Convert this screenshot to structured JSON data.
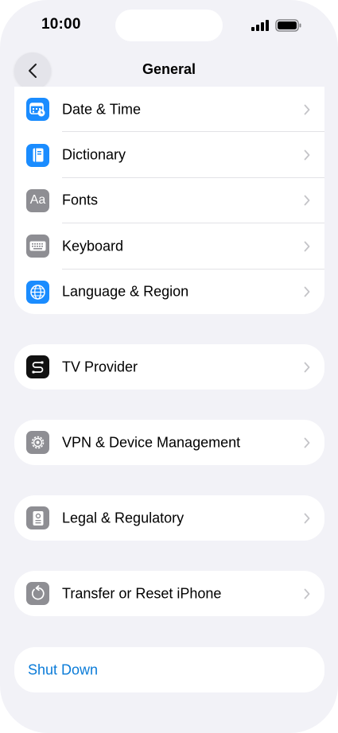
{
  "status_bar": {
    "time": "10:00"
  },
  "nav": {
    "title": "General"
  },
  "groups": {
    "main": [
      {
        "label": "Date & Time",
        "icon": "calendar-clock-icon",
        "color": "#1a8cff"
      },
      {
        "label": "Dictionary",
        "icon": "book-icon",
        "color": "#1a8cff"
      },
      {
        "label": "Fonts",
        "icon": "fonts-icon",
        "icon_text": "Aa",
        "color": "#8e8e93"
      },
      {
        "label": "Keyboard",
        "icon": "keyboard-icon",
        "color": "#8e8e93"
      },
      {
        "label": "Language & Region",
        "icon": "globe-icon",
        "color": "#1a8cff"
      }
    ],
    "tv": {
      "label": "TV Provider",
      "icon": "tv-provider-icon",
      "color": "#111111"
    },
    "vpn": {
      "label": "VPN & Device Management",
      "icon": "gear-icon",
      "color": "#8e8e93"
    },
    "legal": {
      "label": "Legal & Regulatory",
      "icon": "legal-document-icon",
      "color": "#8e8e93"
    },
    "transfer": {
      "label": "Transfer or Reset iPhone",
      "icon": "reset-arrow-icon",
      "color": "#8e8e93"
    },
    "shutdown": {
      "label": "Shut Down",
      "color": "#0a7bd8"
    }
  }
}
